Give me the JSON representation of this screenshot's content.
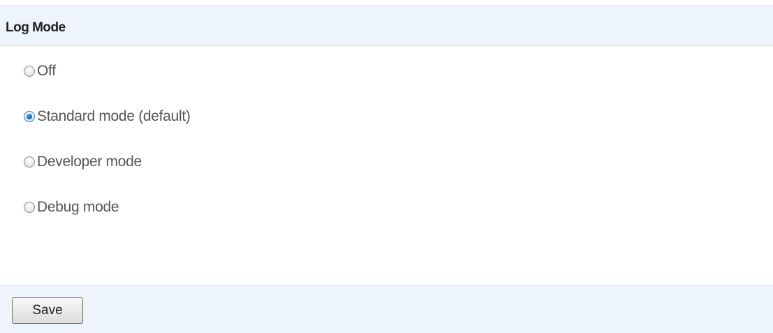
{
  "header": {
    "title": "Log Mode"
  },
  "log_mode": {
    "options": [
      {
        "label": "Off",
        "selected": false
      },
      {
        "label": "Standard mode (default)",
        "selected": true
      },
      {
        "label": "Developer mode",
        "selected": false
      },
      {
        "label": "Debug mode",
        "selected": false
      }
    ]
  },
  "footer": {
    "save_label": "Save"
  },
  "colors": {
    "header_background": "#eef4fc",
    "border": "#cfdceb",
    "selected_radio": "#1e5fa5",
    "label_text": "#555555"
  }
}
